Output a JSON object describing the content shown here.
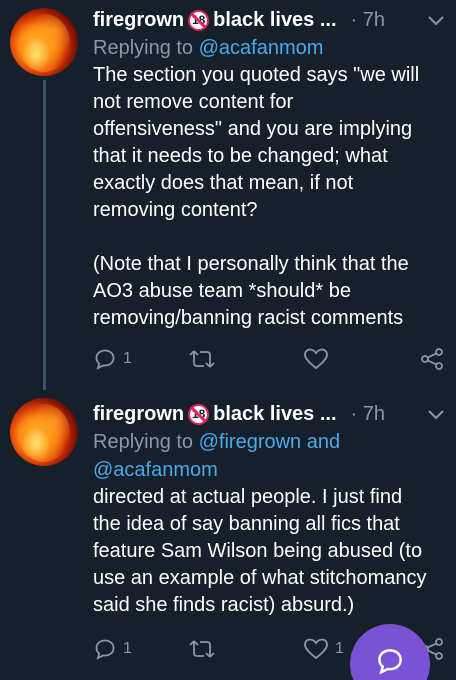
{
  "tweets": [
    {
      "display_name": "firegrown",
      "badge": "18",
      "display_name_suffix": "black lives ...",
      "time": "· 7h",
      "replying_prefix": "Replying to ",
      "replying_to": "@acafanmom",
      "replying_joiner": "",
      "replying_to_2": "",
      "text": "The section you quoted says \"we will\nnot remove content for\noffensiveness\" and you are implying\nthat it needs to be changed; what\nexactly does that mean, if not\nremoving content?\n\n(Note that I personally think that the\nAO3 abuse team *should* be\nremoving/banning racist comments",
      "reply_count": "1",
      "retweet_count": "",
      "like_count": ""
    },
    {
      "display_name": "firegrown",
      "badge": "18",
      "display_name_suffix": "black lives ...",
      "time": "· 7h",
      "replying_prefix": "Replying to ",
      "replying_to": "@firegrown",
      "replying_joiner": " and",
      "replying_to_2": "@acafanmom",
      "text": "directed at actual people. I just find\nthe idea of say banning all fics that\nfeature Sam Wilson being abused (to\nuse an example of what stitchomancy\nsaid she finds racist) absurd.)",
      "reply_count": "1",
      "retweet_count": "",
      "like_count": "1"
    }
  ],
  "icons": {
    "reply": "reply-icon",
    "retweet": "retweet-icon",
    "like": "heart-icon",
    "share": "share-icon",
    "compose": "compose-reply-icon"
  },
  "colors": {
    "background": "#15202b",
    "muted": "#8899a6",
    "link": "#4aa8ec",
    "fab": "#7b52d6",
    "badge": "#e0245e"
  }
}
